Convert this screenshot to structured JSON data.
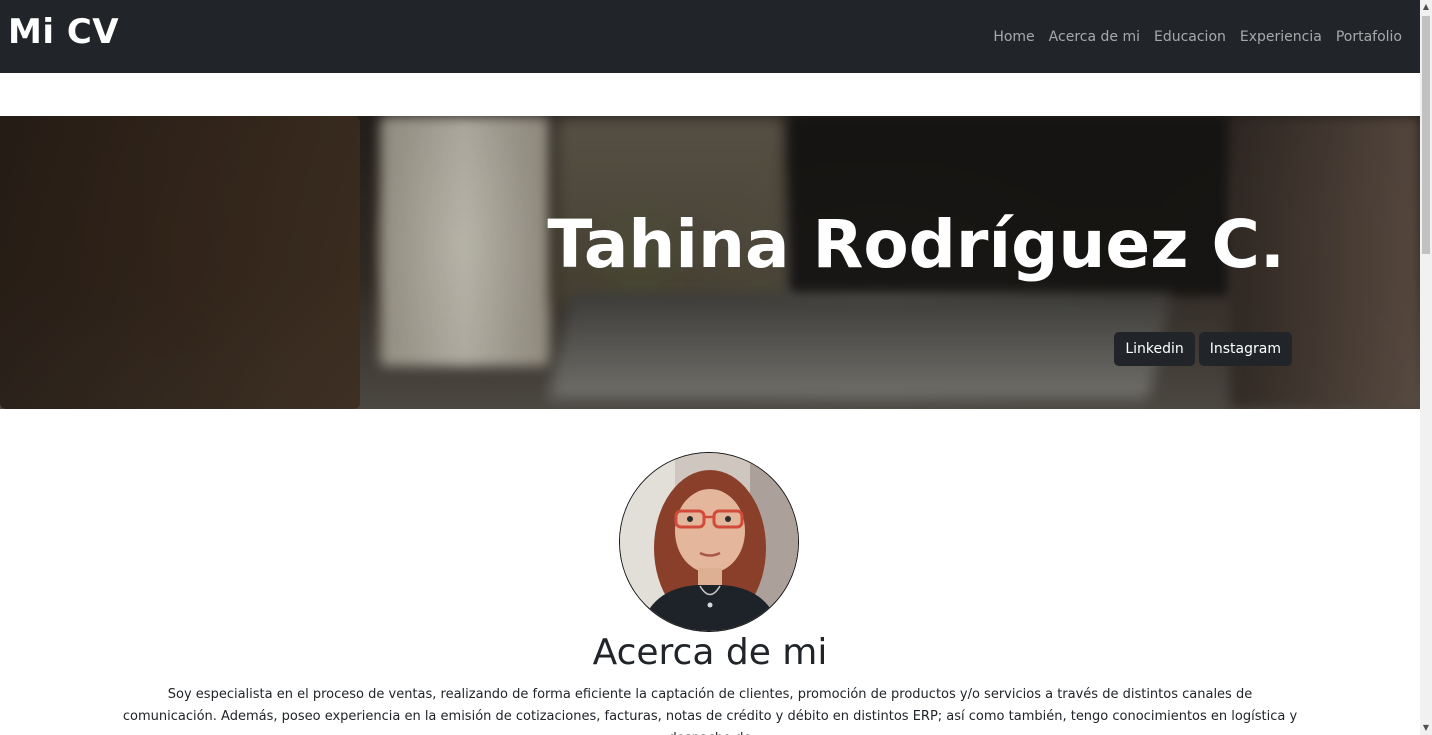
{
  "navbar": {
    "brand": "Mi CV",
    "links": [
      "Home",
      "Acerca de mi",
      "Educacion",
      "Experiencia",
      "Portafolio"
    ]
  },
  "hero": {
    "name": "Tahina Rodríguez C.",
    "buttons": [
      "Linkedin",
      "Instagram"
    ]
  },
  "about": {
    "title": "Acerca de mi",
    "text": "Soy especialista en el proceso de ventas, realizando de forma eficiente la captación de clientes, promoción de productos y/o servicios a través de distintos canales de comunicación. Además, poseo experiencia en la emisión de cotizaciones, facturas, notas de crédito y débito en distintos ERP; así como también, tengo conocimientos en logística y despacho de"
  },
  "colors": {
    "navbar_bg": "#212529",
    "nav_link": "#8b8d90",
    "button_bg": "#212529",
    "page_bg": "#ffffff"
  },
  "icons": {
    "scroll_up": "up-arrow-icon",
    "scroll_down": "down-arrow-icon"
  }
}
